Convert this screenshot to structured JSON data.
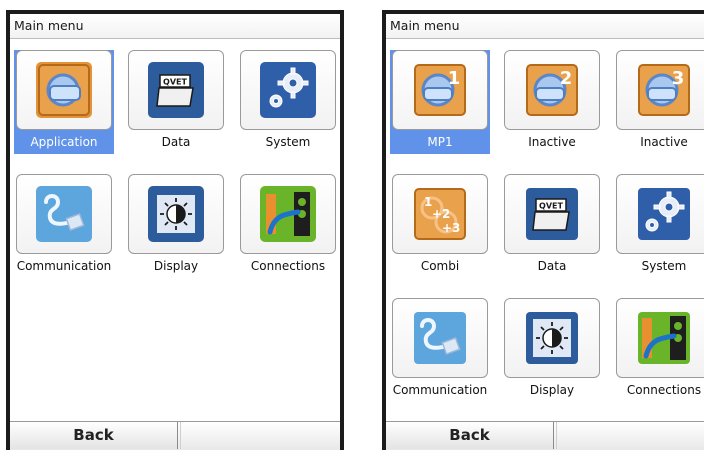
{
  "left_screen": {
    "title": "Main menu",
    "tiles": [
      {
        "label": "Application",
        "icon": "application-icon",
        "selected": true
      },
      {
        "label": "Data",
        "icon": "data-icon"
      },
      {
        "label": "System",
        "icon": "system-gear-icon"
      },
      {
        "label": "Communication",
        "icon": "communication-icon"
      },
      {
        "label": "Display",
        "icon": "display-brightness-icon"
      },
      {
        "label": "Connections",
        "icon": "connections-icon"
      }
    ],
    "back_label": "Back"
  },
  "right_screen": {
    "title": "Main menu",
    "tiles": [
      {
        "label": "MP1",
        "icon": "application-1-icon",
        "badge": "1",
        "selected": true
      },
      {
        "label": "Inactive",
        "icon": "application-2-icon",
        "badge": "2"
      },
      {
        "label": "Inactive",
        "icon": "application-3-icon",
        "badge": "3"
      },
      {
        "label": "Combi",
        "icon": "combi-icon"
      },
      {
        "label": "Data",
        "icon": "data-icon"
      },
      {
        "label": "System",
        "icon": "system-gear-icon"
      },
      {
        "label": "Communication",
        "icon": "communication-icon"
      },
      {
        "label": "Display",
        "icon": "display-brightness-icon"
      },
      {
        "label": "Connections",
        "icon": "connections-icon"
      }
    ],
    "back_label": "Back"
  },
  "data_icon_text": "QVET",
  "colors": {
    "selection": "#5f92e8",
    "application_orange": "#e3933a",
    "data_blue": "#2d5c9c",
    "system_blue": "#2f5fa8",
    "communication_blue": "#5ca5dd",
    "connections_green": "#6ab42a"
  }
}
